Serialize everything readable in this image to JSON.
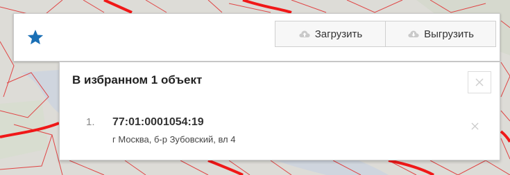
{
  "toolbar": {
    "favorites_icon": "star-icon",
    "upload_label": "Загрузить",
    "download_label": "Выгрузить",
    "upload_icon": "cloud-upload-icon",
    "download_icon": "cloud-download-icon",
    "accent_color": "#1a6fb5"
  },
  "favorites_panel": {
    "title": "В избранном 1 объект",
    "close_icon": "close-icon",
    "items": [
      {
        "index": "1.",
        "cadastral_number": "77:01:0001054:19",
        "address": "г Москва, б-р Зубовский, вл 4",
        "remove_icon": "close-icon"
      }
    ]
  },
  "map": {
    "background_color": "#dcdcd8",
    "parcel_line_color": "#e03a3a",
    "road_color": "#ff0000",
    "river_color": "#d0d6df"
  }
}
